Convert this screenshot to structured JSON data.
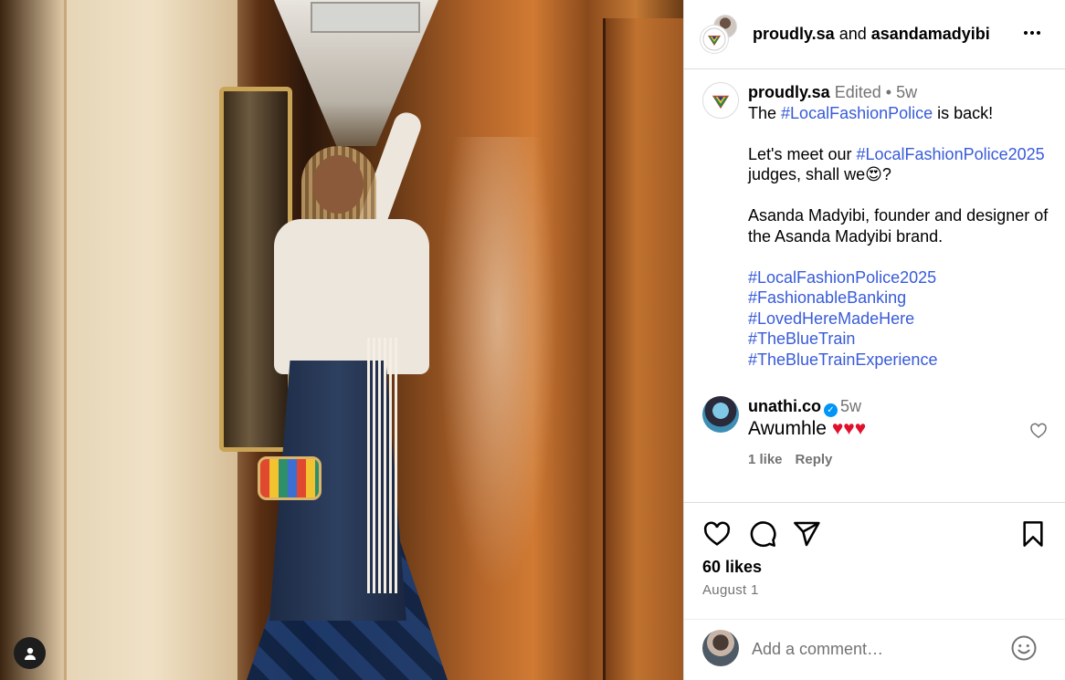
{
  "header": {
    "user1": "proudly.sa",
    "joiner": " and ",
    "user2": "asandamadyibi"
  },
  "caption": {
    "username": "proudly.sa",
    "edited": "Edited",
    "dot": "•",
    "time": "5w",
    "line1_pre": "The ",
    "line1_tag": "#LocalFashionPolice",
    "line1_post": " is back!",
    "line2_pre": "Let's meet our ",
    "line2_tag": "#LocalFashionPolice2025",
    "line2_post": " judges, shall we😍?",
    "line3": "Asanda Madyibi, founder and designer of the Asanda Madyibi brand.",
    "hashtags": [
      "#LocalFashionPolice2025",
      "#FashionableBanking",
      "#LovedHereMadeHere",
      "#TheBlueTrain",
      "#TheBlueTrainExperience"
    ]
  },
  "comment": {
    "username": "unathi.co",
    "time": "5w",
    "text": "Awumhle ",
    "hearts": "♥♥♥",
    "likes": "1 like",
    "reply": "Reply"
  },
  "post": {
    "likes": "60 likes",
    "date": "August 1"
  },
  "add_comment": {
    "placeholder": "Add a comment…"
  },
  "colors": {
    "hashtag": "#385bd9",
    "muted": "#737373",
    "verified": "#0095f6",
    "heart": "#e0112b"
  }
}
